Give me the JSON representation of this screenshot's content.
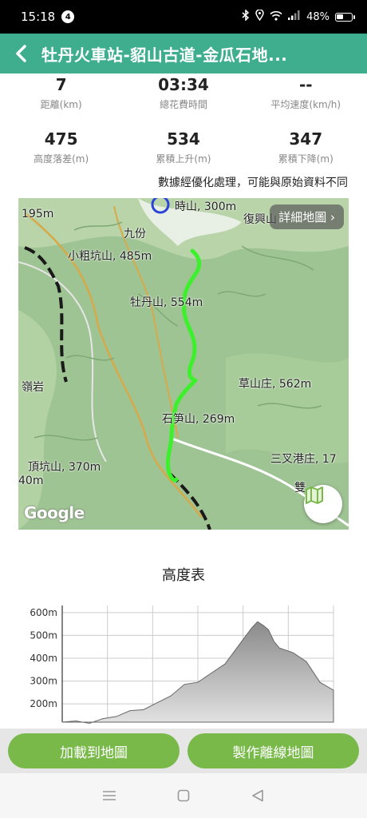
{
  "status_bar": {
    "time": "15:18",
    "notification_count": "4",
    "battery": "48%"
  },
  "header": {
    "title": "牡丹火車站-貂山古道-金瓜石地..."
  },
  "stats": [
    {
      "value": "7",
      "label": "距離(km)"
    },
    {
      "value": "03:34",
      "label": "總花費時間"
    },
    {
      "value": "--",
      "label": "平均速度(km/h)"
    },
    {
      "value": "475",
      "label": "高度落差(m)"
    },
    {
      "value": "534",
      "label": "累積上升(m)"
    },
    {
      "value": "347",
      "label": "累積下降(m)"
    }
  ],
  "note": "數據經優化處理，可能與原始資料不同",
  "map": {
    "detail_button": "詳細地圖 ›",
    "google_logo": "Google",
    "labels": [
      "195m",
      "時山, 300m",
      "復興山",
      "九份",
      "小粗坑山, 485m",
      "牡丹山, 554m",
      "草山庄, 562m",
      "嶺岩",
      "石笋山, 269m",
      "頂坑山, 370m",
      "三叉港庄, 17",
      "40m",
      "雙"
    ]
  },
  "elevation": {
    "title": "高度表",
    "y_ticks": [
      "600m",
      "500m",
      "400m",
      "300m",
      "200m"
    ]
  },
  "chart_data": {
    "type": "area",
    "title": "高度表",
    "ylim": [
      120,
      610
    ],
    "x": [
      0,
      0.05,
      0.1,
      0.15,
      0.2,
      0.25,
      0.3,
      0.35,
      0.4,
      0.45,
      0.5,
      0.55,
      0.6,
      0.65,
      0.7,
      0.72,
      0.74,
      0.76,
      0.78,
      0.8,
      0.85,
      0.9,
      0.95,
      1.0
    ],
    "values": [
      120,
      120,
      120,
      130,
      150,
      165,
      180,
      200,
      240,
      280,
      300,
      330,
      380,
      450,
      540,
      555,
      550,
      520,
      480,
      440,
      430,
      380,
      300,
      260
    ]
  },
  "actions": {
    "load_to_map": "加載到地圖",
    "make_offline_map": "製作離線地圖"
  }
}
